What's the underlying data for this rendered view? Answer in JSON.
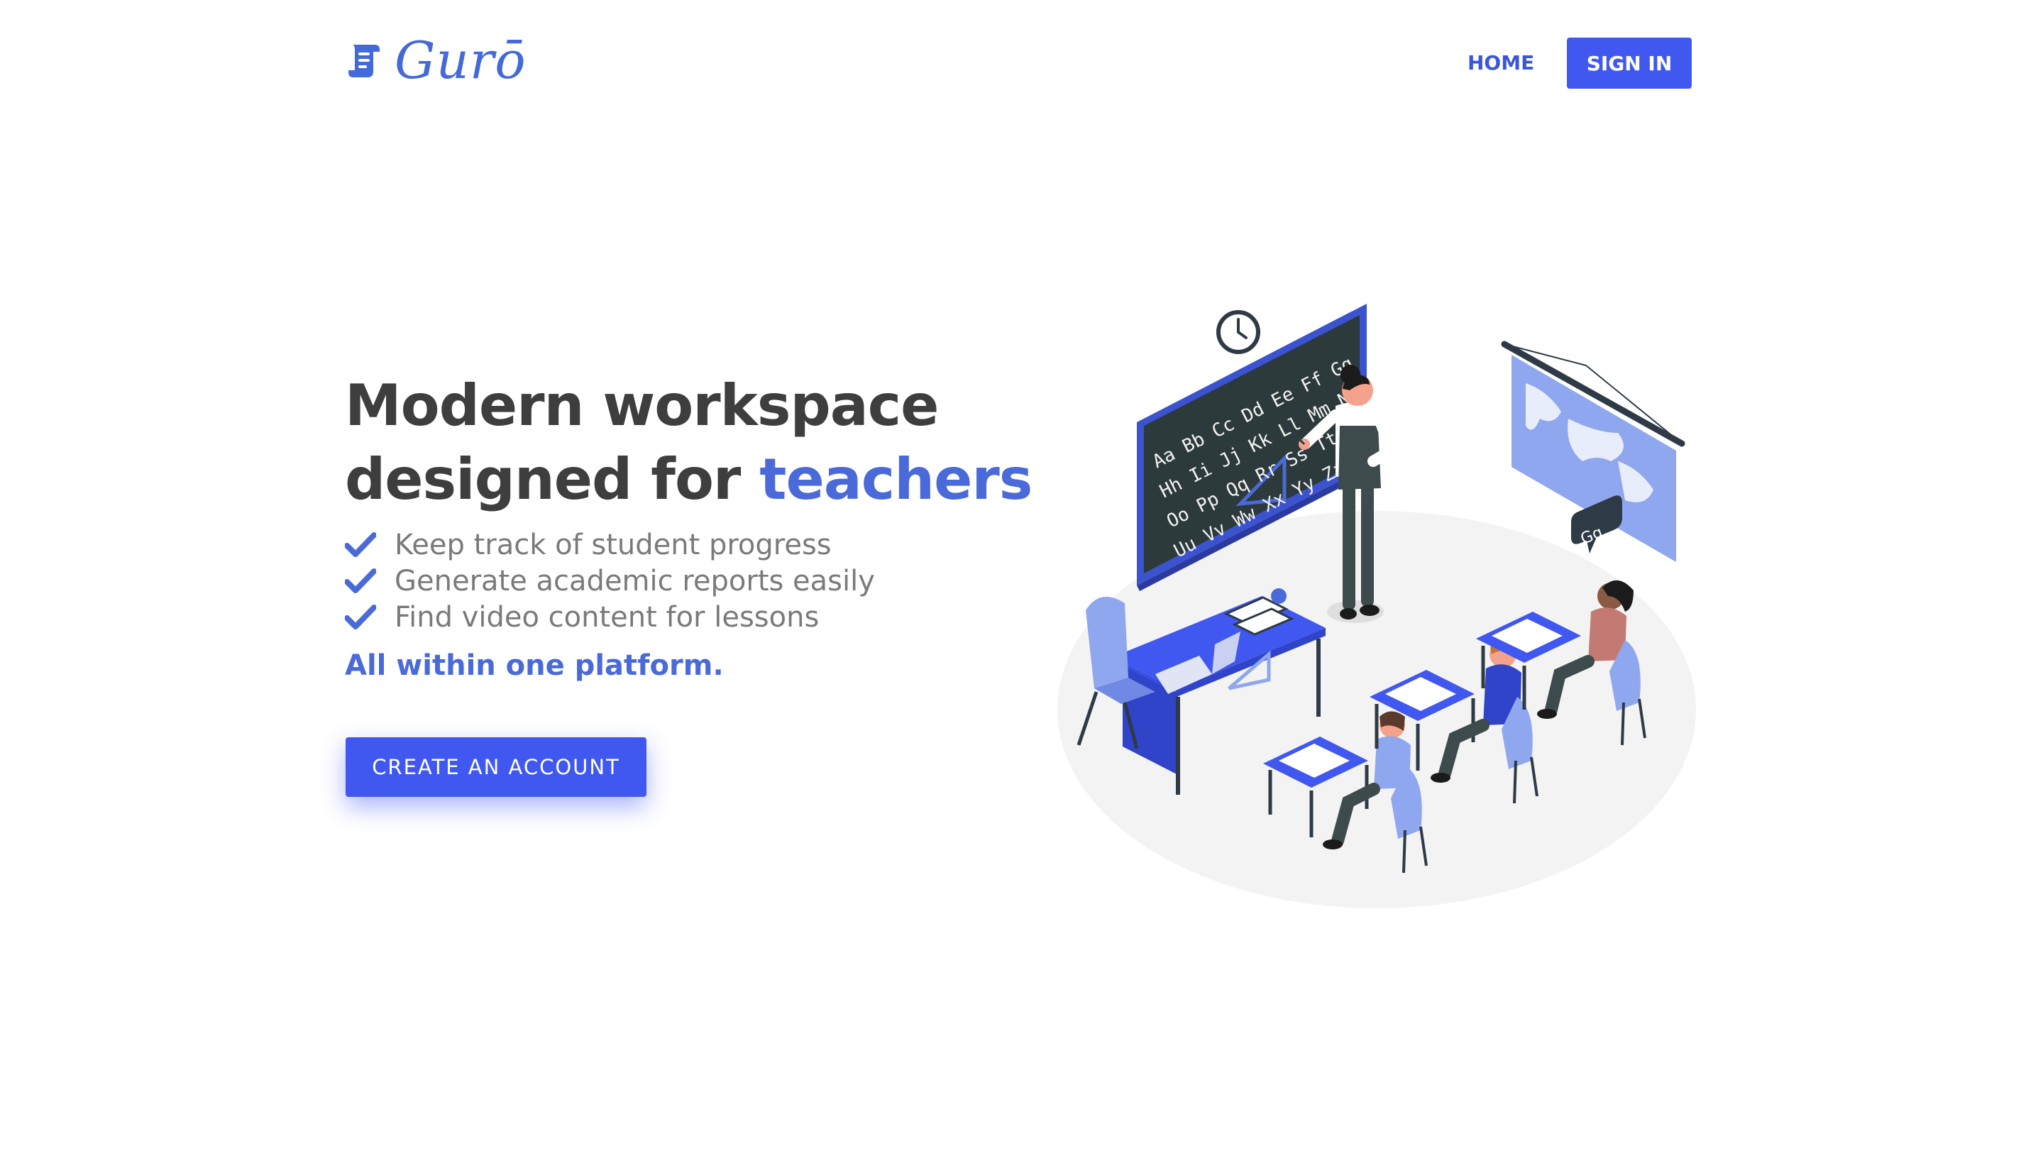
{
  "header": {
    "logo_text": "Gurō",
    "nav": {
      "home_label": "HOME",
      "signin_label": "SIGN IN"
    }
  },
  "hero": {
    "headline_line1": "Modern workspace",
    "headline_line2_prefix": "designed for ",
    "headline_accent": "teachers",
    "features": [
      "Keep track of student progress",
      "Generate academic reports easily",
      "Find video content for lessons"
    ],
    "tagline": "All within one platform.",
    "cta_label": "CREATE AN ACCOUNT"
  },
  "illustration": {
    "chalkboard_rows": [
      "Aa Bb Cc Dd Ee Ff Gg",
      "Hh Ii Jj Kk Ll Mm Nn",
      "Oo Pp Qq Rr Ss Tt",
      "Uu Vv Ww Xx Yy Zz"
    ],
    "speech_bubble": "Gg..."
  },
  "colors": {
    "accent": "#4a6ad9",
    "button": "#4158f0",
    "heading": "#3e3e3e",
    "body_text": "#7a7a7a"
  },
  "icons": [
    "logo-scroll-icon",
    "check-icon"
  ]
}
